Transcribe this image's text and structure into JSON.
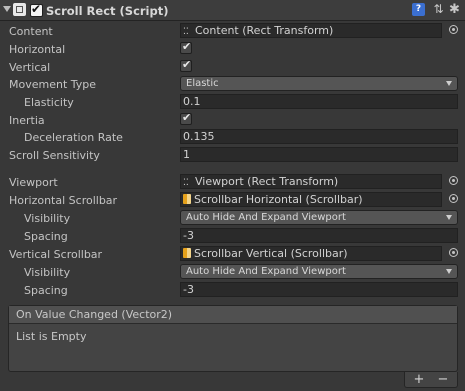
{
  "header": {
    "title": "Scroll Rect (Script)",
    "enabled": true,
    "icons": [
      "component-icon",
      "book-icon",
      "preset-icon",
      "gear-icon"
    ]
  },
  "fields": {
    "content": {
      "label": "Content",
      "value": "Content (Rect Transform)"
    },
    "horizontal": {
      "label": "Horizontal",
      "checked": true
    },
    "vertical": {
      "label": "Vertical",
      "checked": true
    },
    "movement_type": {
      "label": "Movement Type",
      "value": "Elastic"
    },
    "elasticity": {
      "label": "Elasticity",
      "value": "0.1"
    },
    "inertia": {
      "label": "Inertia",
      "checked": true
    },
    "deceleration_rate": {
      "label": "Deceleration Rate",
      "value": "0.135"
    },
    "scroll_sensitivity": {
      "label": "Scroll Sensitivity",
      "value": "1"
    },
    "viewport": {
      "label": "Viewport",
      "value": "Viewport (Rect Transform)"
    },
    "horizontal_scrollbar": {
      "label": "Horizontal Scrollbar",
      "value": "Scrollbar Horizontal (Scrollbar)"
    },
    "h_visibility": {
      "label": "Visibility",
      "value": "Auto Hide And Expand Viewport"
    },
    "h_spacing": {
      "label": "Spacing",
      "value": "-3"
    },
    "vertical_scrollbar": {
      "label": "Vertical Scrollbar",
      "value": "Scrollbar Vertical (Scrollbar)"
    },
    "v_visibility": {
      "label": "Visibility",
      "value": "Auto Hide And Expand Viewport"
    },
    "v_spacing": {
      "label": "Spacing",
      "value": "-3"
    }
  },
  "event": {
    "title": "On Value Changed (Vector2)",
    "empty_text": "List is Empty",
    "add_label": "+",
    "remove_label": "−"
  },
  "glyphs": {
    "check": "✔",
    "book": "?",
    "preset": "⇅",
    "gear": "✱",
    "object": "⁚⁚"
  }
}
